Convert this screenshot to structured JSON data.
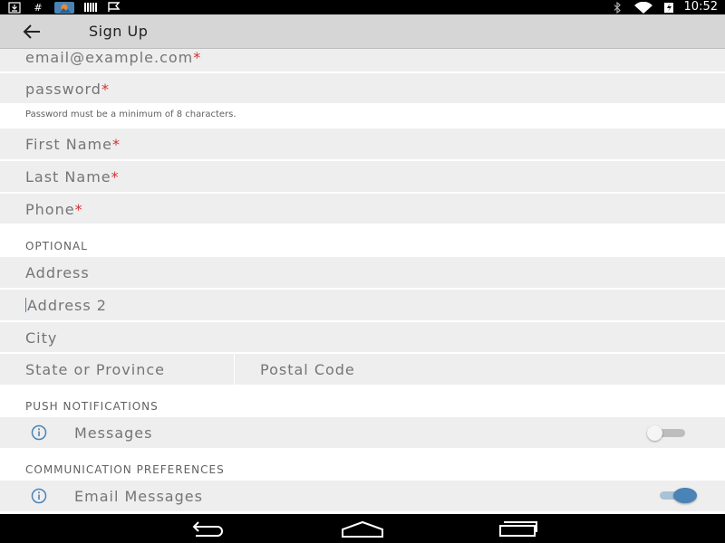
{
  "status_bar": {
    "time": "10:52",
    "left_icons": [
      "download-icon",
      "hash-icon",
      "image-icon",
      "barcode-icon",
      "flag-icon"
    ],
    "right_icons": [
      "bluetooth-icon",
      "wifi-icon",
      "battery-icon"
    ]
  },
  "app_bar": {
    "title": "Sign Up"
  },
  "fields": {
    "email": {
      "placeholder": "email@example.com",
      "required_mark": "*"
    },
    "password": {
      "placeholder": "password",
      "required_mark": "*",
      "hint": "Password must be a minimum of 8 characters."
    },
    "first_name": {
      "placeholder": "First Name",
      "required_mark": "*"
    },
    "last_name": {
      "placeholder": "Last Name",
      "required_mark": "*"
    },
    "phone": {
      "placeholder": "Phone",
      "required_mark": "*"
    }
  },
  "optional": {
    "header": "OPTIONAL",
    "address": "Address",
    "address2": "Address 2",
    "city": "City",
    "state": "State or Province",
    "postal": "Postal Code"
  },
  "push_notifications": {
    "header": "PUSH NOTIFICATIONS",
    "messages": {
      "label": "Messages",
      "enabled": false
    }
  },
  "communication_preferences": {
    "header": "COMMUNICATION PREFERENCES",
    "email_messages": {
      "label": "Email Messages",
      "enabled": true
    }
  },
  "colors": {
    "accent": "#4a83b5",
    "required": "#d32f2f",
    "field_bg": "#eeeeee",
    "app_bar_bg": "#d6d6d6"
  }
}
